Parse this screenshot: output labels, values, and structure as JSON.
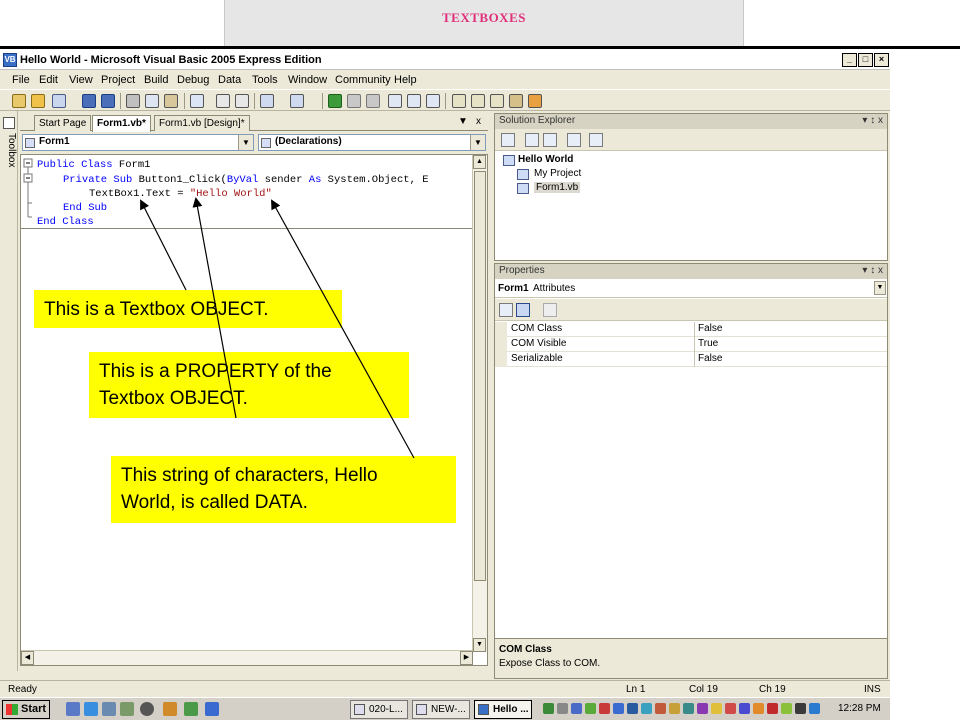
{
  "slide": {
    "title": "TEXTBOXES"
  },
  "window": {
    "title": "Hello World - Microsoft Visual Basic 2005 Express Edition",
    "buttons": {
      "minimize": "_",
      "maximize": "̈",
      "close": "x"
    }
  },
  "menu": {
    "items": [
      "File",
      "Edit",
      "View",
      "Project",
      "Build",
      "Debug",
      "Data",
      "Tools",
      "Window",
      "Community",
      "Help"
    ]
  },
  "toolbox": {
    "label": "Toolbox"
  },
  "editor": {
    "tabs": [
      "Start Page",
      "Form1.vb*",
      "Form1.vb [Design]*"
    ],
    "tab_controls": {
      "dropdown": "▼",
      "close": "x"
    },
    "class_dropdown": "Form1",
    "method_dropdown": "(Declarations)",
    "code": {
      "line1": {
        "kw1": "Public Class",
        "rest": " Form1"
      },
      "line2": {
        "kw1": "Private Sub",
        "mid": " Button1_Click(",
        "kw2": "ByVal",
        "mid2": " sender ",
        "kw3": "As",
        "rest": " System.Object, E"
      },
      "line3": {
        "plain": "TextBox1.Text = ",
        "string": "\"Hello World\""
      },
      "line4": {
        "kw1": "End Sub"
      },
      "line5": {
        "kw1": "End Class"
      }
    }
  },
  "solution_explorer": {
    "title": "Solution Explorer",
    "controls": "▾ ↕ x",
    "project": "Hello World",
    "items": [
      "My Project",
      "Form1.vb"
    ]
  },
  "properties": {
    "title": "Properties",
    "controls": "▾ ↕ x",
    "object": {
      "name": "Form1",
      "type": "Attributes"
    },
    "rows": [
      {
        "name": "COM Class",
        "value": "False"
      },
      {
        "name": "COM Visible",
        "value": "True"
      },
      {
        "name": "Serializable",
        "value": "False"
      }
    ],
    "description": {
      "title": "COM Class",
      "text": "Expose Class to COM."
    }
  },
  "statusbar": {
    "status": "Ready",
    "line": "Ln 1",
    "col": "Col 19",
    "ch": "Ch 19",
    "mode": "INS"
  },
  "taskbar": {
    "start": "Start",
    "tasks": [
      "020-L...",
      "NEW-...",
      "Hello ..."
    ],
    "clock": "12:28 PM"
  },
  "callouts": {
    "object": "This is a Textbox OBJECT.",
    "property_line1": "This is a PROPERTY of the",
    "property_line2": "Textbox OBJECT.",
    "data_line1": "This string of characters, Hello",
    "data_line2": "World, is called DATA."
  },
  "colors": {
    "keyword": "#0000ff",
    "string": "#a31515",
    "callout": "#ffff00",
    "slide_title": "#e0307a"
  }
}
